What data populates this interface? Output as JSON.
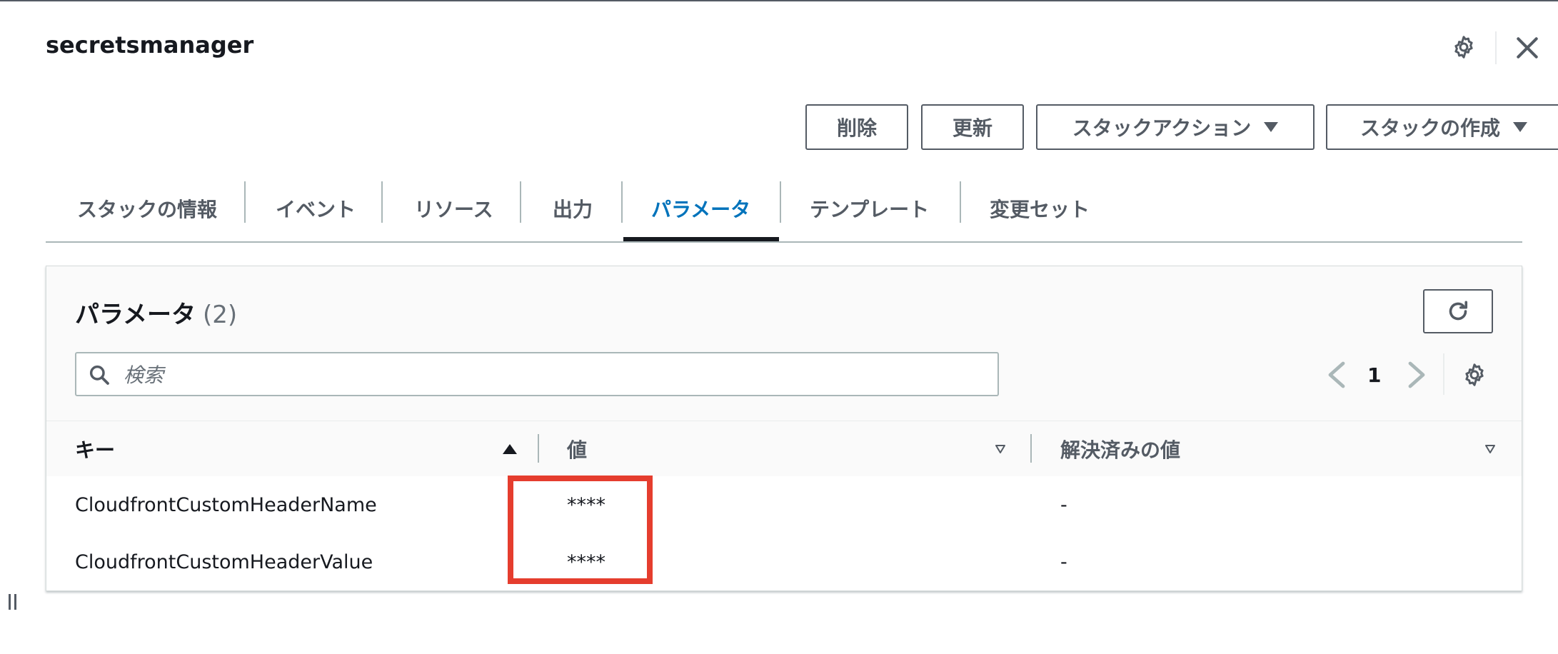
{
  "header": {
    "title": "secretsmanager"
  },
  "actions": {
    "delete_label": "削除",
    "update_label": "更新",
    "stack_actions_label": "スタックアクション",
    "create_stack_label": "スタックの作成"
  },
  "tabs": [
    {
      "label": "スタックの情報"
    },
    {
      "label": "イベント"
    },
    {
      "label": "リソース"
    },
    {
      "label": "出力"
    },
    {
      "label": "パラメータ",
      "active": true
    },
    {
      "label": "テンプレート"
    },
    {
      "label": "変更セット"
    }
  ],
  "panel": {
    "title": "パラメータ",
    "count": "(2)",
    "search_placeholder": "検索",
    "page": "1"
  },
  "table": {
    "columns": [
      "キー",
      "値",
      "解決済みの値"
    ],
    "rows": [
      {
        "key": "CloudfrontCustomHeaderName",
        "value": "****",
        "resolved": "-"
      },
      {
        "key": "CloudfrontCustomHeaderValue",
        "value": "****",
        "resolved": "-"
      }
    ]
  },
  "colors": {
    "accent": "#0073bb",
    "highlight_border": "#e53d2e",
    "text": "#16191f",
    "secondary_text": "#545b64"
  },
  "icons": [
    "gear-icon",
    "close-icon",
    "caret-down-icon",
    "refresh-icon",
    "search-icon",
    "chevron-left-icon",
    "chevron-right-icon",
    "sort-ascending-icon",
    "sort-descending-icon",
    "resize-handle-icon"
  ]
}
